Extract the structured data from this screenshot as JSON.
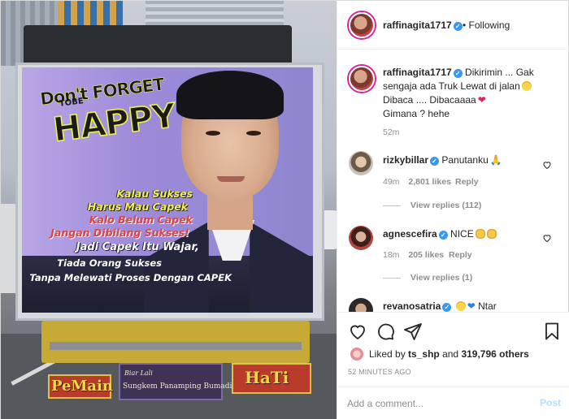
{
  "photo": {
    "headline_small": "Don't FORGET",
    "headline_tobe": "TOBE",
    "headline_big": "HAPPY",
    "quote_lines": [
      "Kalau Sukses",
      "Harus Mau Capek",
      "Kalo Belum Capek",
      "Jangan Dibilang Sukses!",
      "Jadi Capek Itu Wajar,",
      "Tiada Orang Sukses",
      "Tanpa Melewati Proses Dengan CAPEK"
    ],
    "plate_left": "PeMain",
    "plate_right": "HaTi",
    "plate_center_top": "Biar Lali",
    "plate_center_bottom": "Sungkem Panamping Bumadi"
  },
  "header": {
    "username": "raffinagita1717",
    "separator": "•",
    "follow_label": "Following"
  },
  "caption": {
    "username": "raffinagita1717",
    "line1": "Dikirimin ... Gak",
    "line2": "sengaja ada Truk Lewat di jalan",
    "line3": "Dibaca .... Dibacaaaa",
    "line4": "Gimana ? hehe",
    "time": "52m"
  },
  "comments": [
    {
      "username": "rizkybillar",
      "text": "Panutanku",
      "time": "49m",
      "likes": "2,801 likes",
      "reply_label": "Reply",
      "view_replies": "View replies (112)"
    },
    {
      "username": "agnescefira",
      "text": "NICE",
      "time": "18m",
      "likes": "205 likes",
      "reply_label": "Reply",
      "view_replies": "View replies (1)"
    },
    {
      "username": "revanosatria",
      "text": "Ntar"
    }
  ],
  "likes": {
    "prefix": "Liked by",
    "user": "ts_shp",
    "connector": "and",
    "count": "319,796 others"
  },
  "timestamp": "52 MINUTES AGO",
  "add_comment": {
    "placeholder": "Add a comment...",
    "post_label": "Post"
  },
  "colors": {
    "verified": "#3897f0",
    "post_disabled": "#b2dffc",
    "muted": "#8e8e8e",
    "text": "#262626"
  },
  "icons": [
    "heart-icon",
    "comment-icon",
    "share-icon",
    "bookmark-icon",
    "verified-icon"
  ]
}
